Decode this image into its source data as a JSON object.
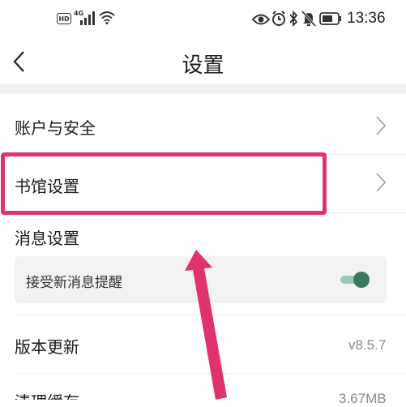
{
  "status_bar": {
    "hd": "HD",
    "network": "4G",
    "time": "13:36",
    "icons": [
      "signal-icon",
      "wifi-icon",
      "eye-icon",
      "alarm-icon",
      "bluetooth-icon",
      "mute-icon",
      "battery-icon"
    ]
  },
  "header": {
    "title": "设置",
    "back_icon": "back-chevron-icon"
  },
  "settings": {
    "account_security": "账户与安全",
    "library_settings": "书馆设置",
    "message_settings": "消息设置",
    "receive_new_message_reminder": "接受新消息提醒",
    "receive_new_message_enabled": true,
    "version_update": "版本更新",
    "version_value": "v8.5.7",
    "clear_cache": "清理缓存",
    "cache_value": "3.67MB"
  },
  "annotation": {
    "highlight_color": "#e0336e",
    "arrow_color": "#e0336e"
  },
  "colors": {
    "toggle_on": "#3d7a5a",
    "toggle_track": "#9fc9b4",
    "section_bg": "#f1f1f1"
  }
}
